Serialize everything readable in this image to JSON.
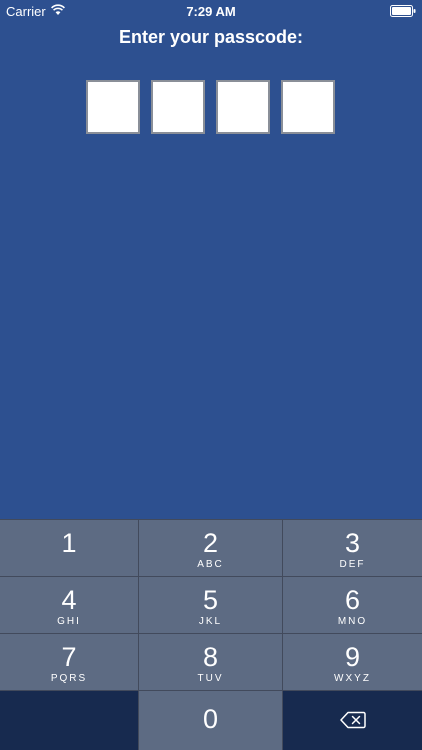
{
  "status_bar": {
    "carrier": "Carrier",
    "time": "7:29 AM",
    "wifi_icon": "wifi-icon",
    "battery_icon": "battery-icon"
  },
  "prompt": "Enter your passcode:",
  "passcode_boxes": [
    "",
    "",
    "",
    ""
  ],
  "keypad": {
    "keys": [
      {
        "number": "1",
        "letters": ""
      },
      {
        "number": "2",
        "letters": "ABC"
      },
      {
        "number": "3",
        "letters": "DEF"
      },
      {
        "number": "4",
        "letters": "GHI"
      },
      {
        "number": "5",
        "letters": "JKL"
      },
      {
        "number": "6",
        "letters": "MNO"
      },
      {
        "number": "7",
        "letters": "PQRS"
      },
      {
        "number": "8",
        "letters": "TUV"
      },
      {
        "number": "9",
        "letters": "WXYZ"
      },
      {
        "number": "0",
        "letters": ""
      }
    ],
    "delete_icon": "delete-backspace-icon"
  },
  "colors": {
    "background": "#2d5090",
    "key": "#5d6b83",
    "key_dark": "#172a4f",
    "box": "#ffffff"
  }
}
